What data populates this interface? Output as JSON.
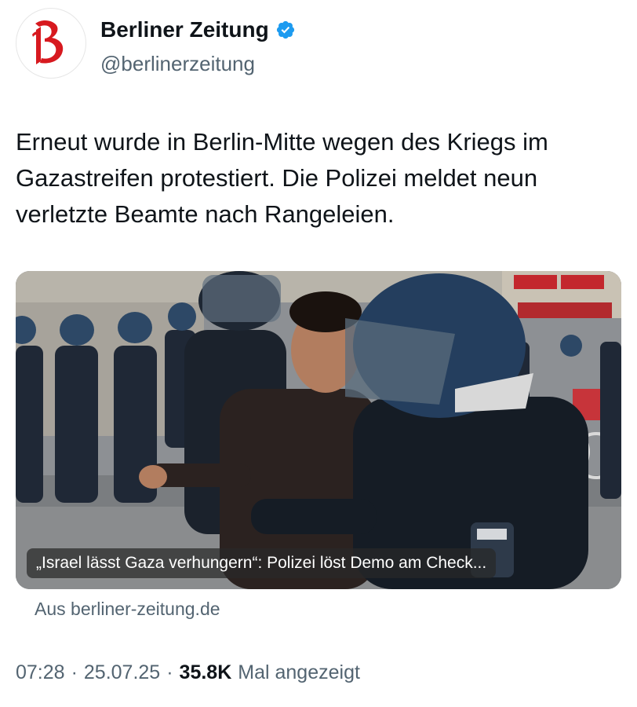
{
  "account": {
    "name": "Berliner Zeitung",
    "handle": "@berlinerzeitung",
    "verified": true,
    "avatar_icon": "blackletter-b-logo-icon",
    "brand_color": "#d7191f",
    "verified_color": "#1d9bf0"
  },
  "tweet": {
    "text": "Erneut wurde in Berlin-Mitte wegen des Kriegs im Gazastreifen protestiert. Die Polizei meldet neun verletzte Beamte nach Rangeleien."
  },
  "link_card": {
    "caption": "„Israel lässt Gaza verhungern“: Polizei löst Demo am Check...",
    "source": "Aus berliner-zeitung.de"
  },
  "meta": {
    "time": "07:28",
    "date": "25.07.25",
    "views_count": "35.8K",
    "views_label": "Mal angezeigt"
  }
}
